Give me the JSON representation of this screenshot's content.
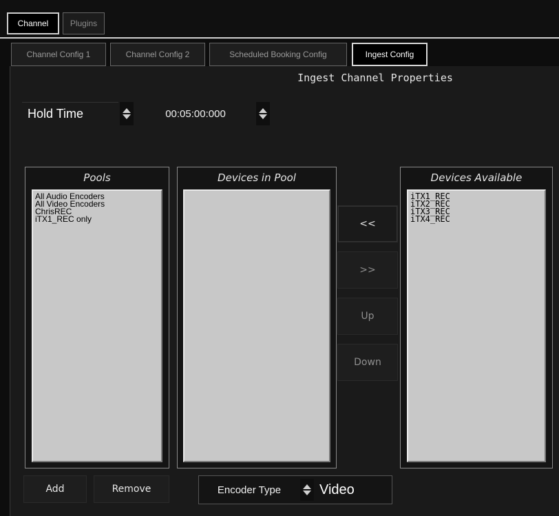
{
  "top_tabs": [
    {
      "label": "Channel",
      "active": true
    },
    {
      "label": "Plugins",
      "active": false
    }
  ],
  "config_tabs": [
    {
      "label": "Channel Config 1",
      "active": false
    },
    {
      "label": "Channel Config 2",
      "active": false
    },
    {
      "label": "Scheduled Booking Config",
      "active": false
    },
    {
      "label": "Ingest Config",
      "active": true
    }
  ],
  "section_title": "Ingest Channel Properties",
  "hold_time": {
    "label": "Hold Time",
    "value": "00:05:00:000"
  },
  "pools": {
    "title": "Pools",
    "items": [
      "All Audio Encoders",
      "All Video Encoders",
      "ChrisREC",
      "iTX1_REC only"
    ]
  },
  "devices_in_pool": {
    "title": "Devices in Pool",
    "items": []
  },
  "devices_available": {
    "title": "Devices Available",
    "items": [
      "iTX1_REC",
      "iTX2_REC",
      "iTX3_REC",
      "iTX4_REC"
    ]
  },
  "buttons": {
    "move_left": "<<",
    "move_right": ">>",
    "up": "Up",
    "down": "Down",
    "add": "Add",
    "remove": "Remove"
  },
  "encoder_type": {
    "label": "Encoder Type",
    "value": "Video"
  },
  "icons": [
    "spin-up-down-icon"
  ]
}
